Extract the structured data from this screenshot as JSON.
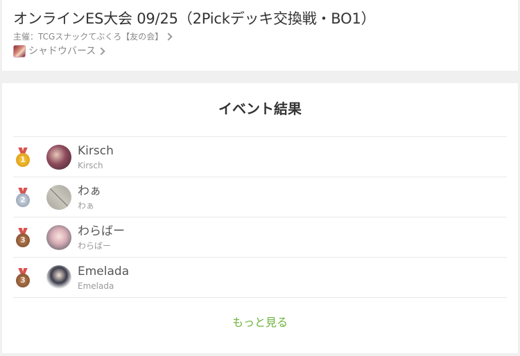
{
  "event": {
    "title": "オンラインES大会 09/25（2Pickデッキ交換戦・BO1）",
    "organizer": "主催：TCGスナックてぶくろ【友の会】",
    "game": "シャドウバース"
  },
  "results": {
    "title": "イベント結果",
    "rows": [
      {
        "rank": "1",
        "medal": "gold",
        "display_name": "Kirsch",
        "user_id": "Kirsch"
      },
      {
        "rank": "2",
        "medal": "silver",
        "display_name": "わぁ",
        "user_id": "わぁ"
      },
      {
        "rank": "3",
        "medal": "bronze",
        "display_name": "わらばー",
        "user_id": "わらばー"
      },
      {
        "rank": "3",
        "medal": "bronze",
        "display_name": "Emelada",
        "user_id": "Emelada"
      }
    ],
    "more_label": "もっと見る"
  },
  "colors": {
    "accent": "#6cb33e",
    "text": "#333333",
    "muted": "#999999"
  }
}
